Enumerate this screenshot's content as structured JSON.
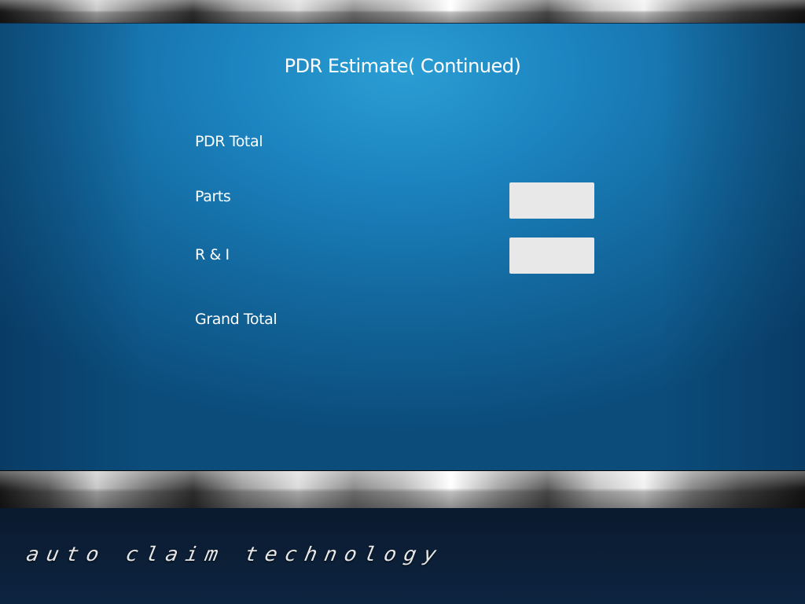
{
  "page": {
    "title": "PDR Estimate( Continued)"
  },
  "fields": {
    "pdr_total_label": "PDR Total",
    "parts_label": "Parts",
    "parts_value": "",
    "ri_label": "R & I",
    "ri_value": "",
    "grand_total_label": "Grand Total"
  },
  "footer": {
    "brand": "auto claim technology"
  },
  "colors": {
    "panel_blue": "#1c84c0",
    "input_fill": "#e8e8e8",
    "footer_dark": "#0d2440"
  }
}
